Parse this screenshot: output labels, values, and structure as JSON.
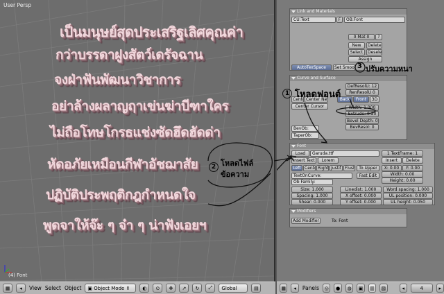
{
  "viewport": {
    "label": "User Persp",
    "footer": "(4) Font",
    "thai_lines": [
      "เป็นมนุษย์สุดประเสริฐเลิศคุณค่า",
      "กว่าบรรดาฝูงสัตว์เดรัจฉาน",
      "จงฝ่าฟันพัฒนาวิชาการ",
      "อย่าล้างผลาญฤาเข่นฆ่าบีฑาใคร",
      "ไม่ถือโทษโกรธแช่งซัดฮึดฮัดด่า",
      "หัดอภัยเหมือนกีฬาอัชฌาสัย",
      "ปฏิบัติประพฤติกฎกำหนดใจ",
      "พูดจาให้จ๊ะ ๆ จ๋า ๆ น่าฟังเอยฯ"
    ]
  },
  "header_left": {
    "menus": [
      "View",
      "Select",
      "Object"
    ],
    "mode": "Object Mode",
    "pivot": "Global"
  },
  "header_right": {
    "panels_label": "Panels",
    "frame": "4"
  },
  "link_materials": {
    "title": "Link and Materials",
    "cu_text": "CU:Text",
    "f_btn": "F",
    "ob_font": "OB:Font",
    "mat": "0 Mat 0",
    "q": "?",
    "new": "New",
    "delete": "Delete",
    "select": "Select",
    "deselect": "Deselect",
    "assign": "Assign",
    "autotex": "AutoTexSpace",
    "set_smooth": "Set Smoot"
  },
  "curve_surface": {
    "title": "Curve and Surface",
    "defresolu": "DefResolU: 12",
    "renresolu": "RenResolU 0",
    "back": "Back",
    "front": "Front",
    "three_d": "3D",
    "width": "Width: 1.000",
    "extrude": "Extrude: 0.20",
    "bevel_depth": "Bevel Depth: 0.000",
    "bevresol": "BevResol: 0",
    "bevob": "BevOb:",
    "taperob": "TaperOb:",
    "center": "Center",
    "center_new": "Center New",
    "center_cursor": "Center Cursor"
  },
  "font": {
    "title": "Font",
    "load": "Load",
    "font_name": "Garuda.ttf",
    "insert_text": "Insert Text",
    "lorem": "Lorem",
    "textframe": "1 TextFrame: 1",
    "insert": "Insert",
    "delete": "Delete",
    "align": [
      "Left",
      "Cente",
      "Right",
      "Justif",
      "Flush"
    ],
    "to_upper": "To Upper",
    "x": "X: 0.00",
    "y": "Y: 0.00",
    "width": "Width: 0.00",
    "height": "Height: 0.00",
    "textoncurve": "TextOnCurve:",
    "fast_edit": "Fast Edit",
    "ob_family": "Ob Family:",
    "size": "Size: 1.000",
    "linedist": "Linedist: 1.000",
    "word_spacing": "Word spacing: 1.000",
    "spacing": "Spacing: 1.000",
    "x_offset": "X offset: 0.000",
    "ul_position": "UL position: 0.000",
    "shear": "Shear: 0.000",
    "y_offset": "Y offset: 0.000",
    "ul_height": "UL height: 0.050"
  },
  "modifiers": {
    "title": "Modifiers",
    "add_modifier": "Add Modifier",
    "to": "To: Font"
  },
  "annotations": {
    "n1": "1",
    "a1": "โหลดฟอนต์",
    "n2": "2",
    "a2_line1": "โหลดไฟล์",
    "a2_line2": "ข้อความ",
    "n3": "3",
    "a3": "ปรับความหนา"
  },
  "colors": {
    "viewport_bg": "#6d6d6d",
    "panel_bg": "#a4a4a4",
    "text_pink": "#f1d7dc",
    "active_blue": "#5c6d95"
  }
}
